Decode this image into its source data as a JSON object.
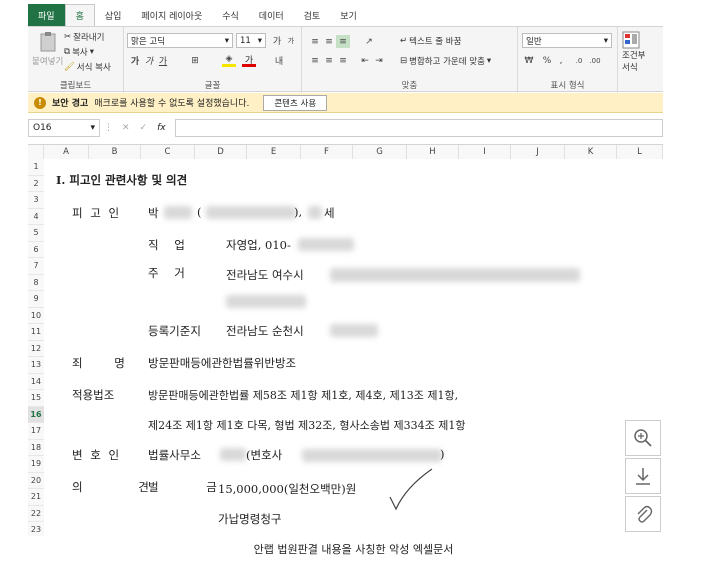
{
  "ribbon_tabs": [
    "파일",
    "홈",
    "삽입",
    "페이지 레이아웃",
    "수식",
    "데이터",
    "검토",
    "보기"
  ],
  "clipboard": {
    "paste": "붙여넣기",
    "cut": "잘라내기",
    "copy": "복사",
    "format_painter": "서식 복사",
    "group": "클립보드"
  },
  "font": {
    "name": "맑은 고딕",
    "size": "11",
    "bold": "가",
    "italic": "가",
    "underline": "가",
    "group": "글꼴",
    "grow": "가",
    "shrink": "가"
  },
  "alignment": {
    "wrap": "텍스트 줄 바꿈",
    "merge": "병합하고 가운데 맞춤",
    "group": "맞춤"
  },
  "number": {
    "format": "일반",
    "percent": "%",
    "comma": ",",
    "group": "표시 형식"
  },
  "styles": {
    "conditional": "조건부",
    "conditional2": "서식"
  },
  "security": {
    "label": "보안 경고",
    "message": "매크로를 사용할 수 없도록 설정했습니다.",
    "button": "콘텐츠 사용"
  },
  "formula_bar": {
    "cell": "O16",
    "fx": "fx"
  },
  "columns": [
    "A",
    "B",
    "C",
    "D",
    "E",
    "F",
    "G",
    "H",
    "I",
    "J",
    "K",
    "L"
  ],
  "rows": [
    "1",
    "2",
    "3",
    "4",
    "5",
    "6",
    "7",
    "8",
    "9",
    "10",
    "11",
    "12",
    "13",
    "14",
    "15",
    "16",
    "17",
    "18",
    "19",
    "20",
    "21",
    "22",
    "23"
  ],
  "doc": {
    "title": "Ⅰ. 피고인 관련사항 및 의견",
    "defendant_label": "피 고 인",
    "defendant_name": "박",
    "paren_open": "(",
    "paren_close": "),",
    "age_suffix": "세",
    "job_label": "직 업",
    "job_value": "자영업, 010-",
    "address_label": "주 거",
    "address_value": "전라남도 여수시",
    "registry_label": "등록기준지",
    "registry_value": "전라남도 순천시",
    "crime_label": "죄 명",
    "crime_value": "방문판매등에관한법률위반방조",
    "law_label": "적용법조",
    "law_line1": "방문판매등에관한법률 제58조 제1항 제1호, 제4호, 제13조 제1항,",
    "law_line2": "제24조 제1항 제1호 다목, 형법 제32조, 형사소송법 제334조 제1항",
    "lawyer_label": "변 호 인",
    "lawyer_value": "법률사무소",
    "lawyer_suffix": "(변호사",
    "lawyer_close": ")",
    "opinion_label": "의 견",
    "fine_label": "벌 금",
    "fine_value": "15,000,000(일천오백만)원",
    "provisional": "가납명령청구"
  },
  "caption": "안랩 법원판결 내용을 사칭한 악성 엑셀문서",
  "side_icons": [
    "zoom-in-icon",
    "download-icon",
    "attach-icon"
  ]
}
